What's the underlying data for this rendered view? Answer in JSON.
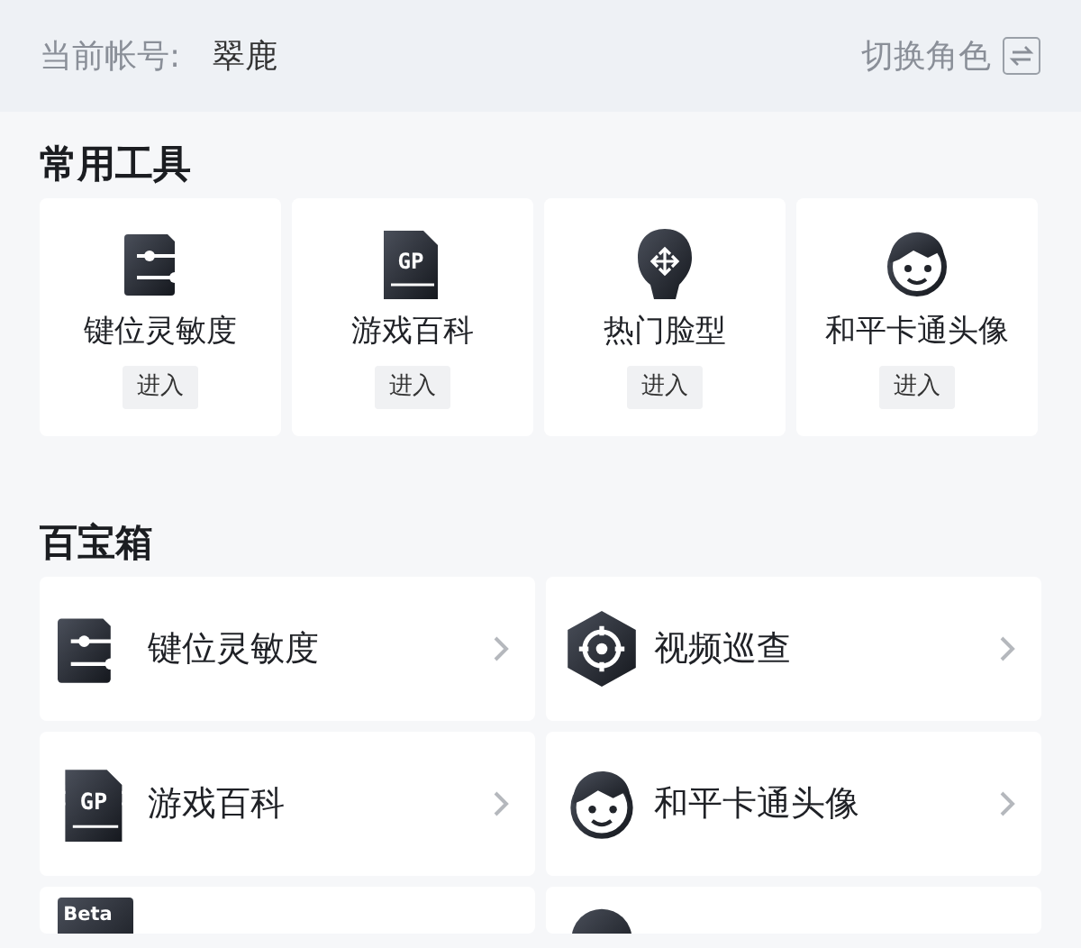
{
  "account": {
    "label": "当前帐号:",
    "name": "翠鹿",
    "switch_label": "切换角色"
  },
  "common_tools": {
    "title": "常用工具",
    "items": [
      {
        "kind": "sliders",
        "label": "键位灵敏度",
        "action": "进入"
      },
      {
        "kind": "gp",
        "badge": "GP",
        "label": "游戏百科",
        "action": "进入"
      },
      {
        "kind": "face-move",
        "label": "热门脸型",
        "action": "进入"
      },
      {
        "kind": "cartoon",
        "label": "和平卡通头像",
        "action": "进入"
      }
    ]
  },
  "treasure_box": {
    "title": "百宝箱",
    "items": [
      {
        "kind": "sliders",
        "label": "键位灵敏度"
      },
      {
        "kind": "target",
        "label": "视频巡查"
      },
      {
        "kind": "gp",
        "badge": "GP",
        "label": "游戏百科"
      },
      {
        "kind": "cartoon",
        "label": "和平卡通头像"
      },
      {
        "kind": "beta",
        "badge": "Beta"
      },
      {
        "kind": "round"
      }
    ]
  }
}
